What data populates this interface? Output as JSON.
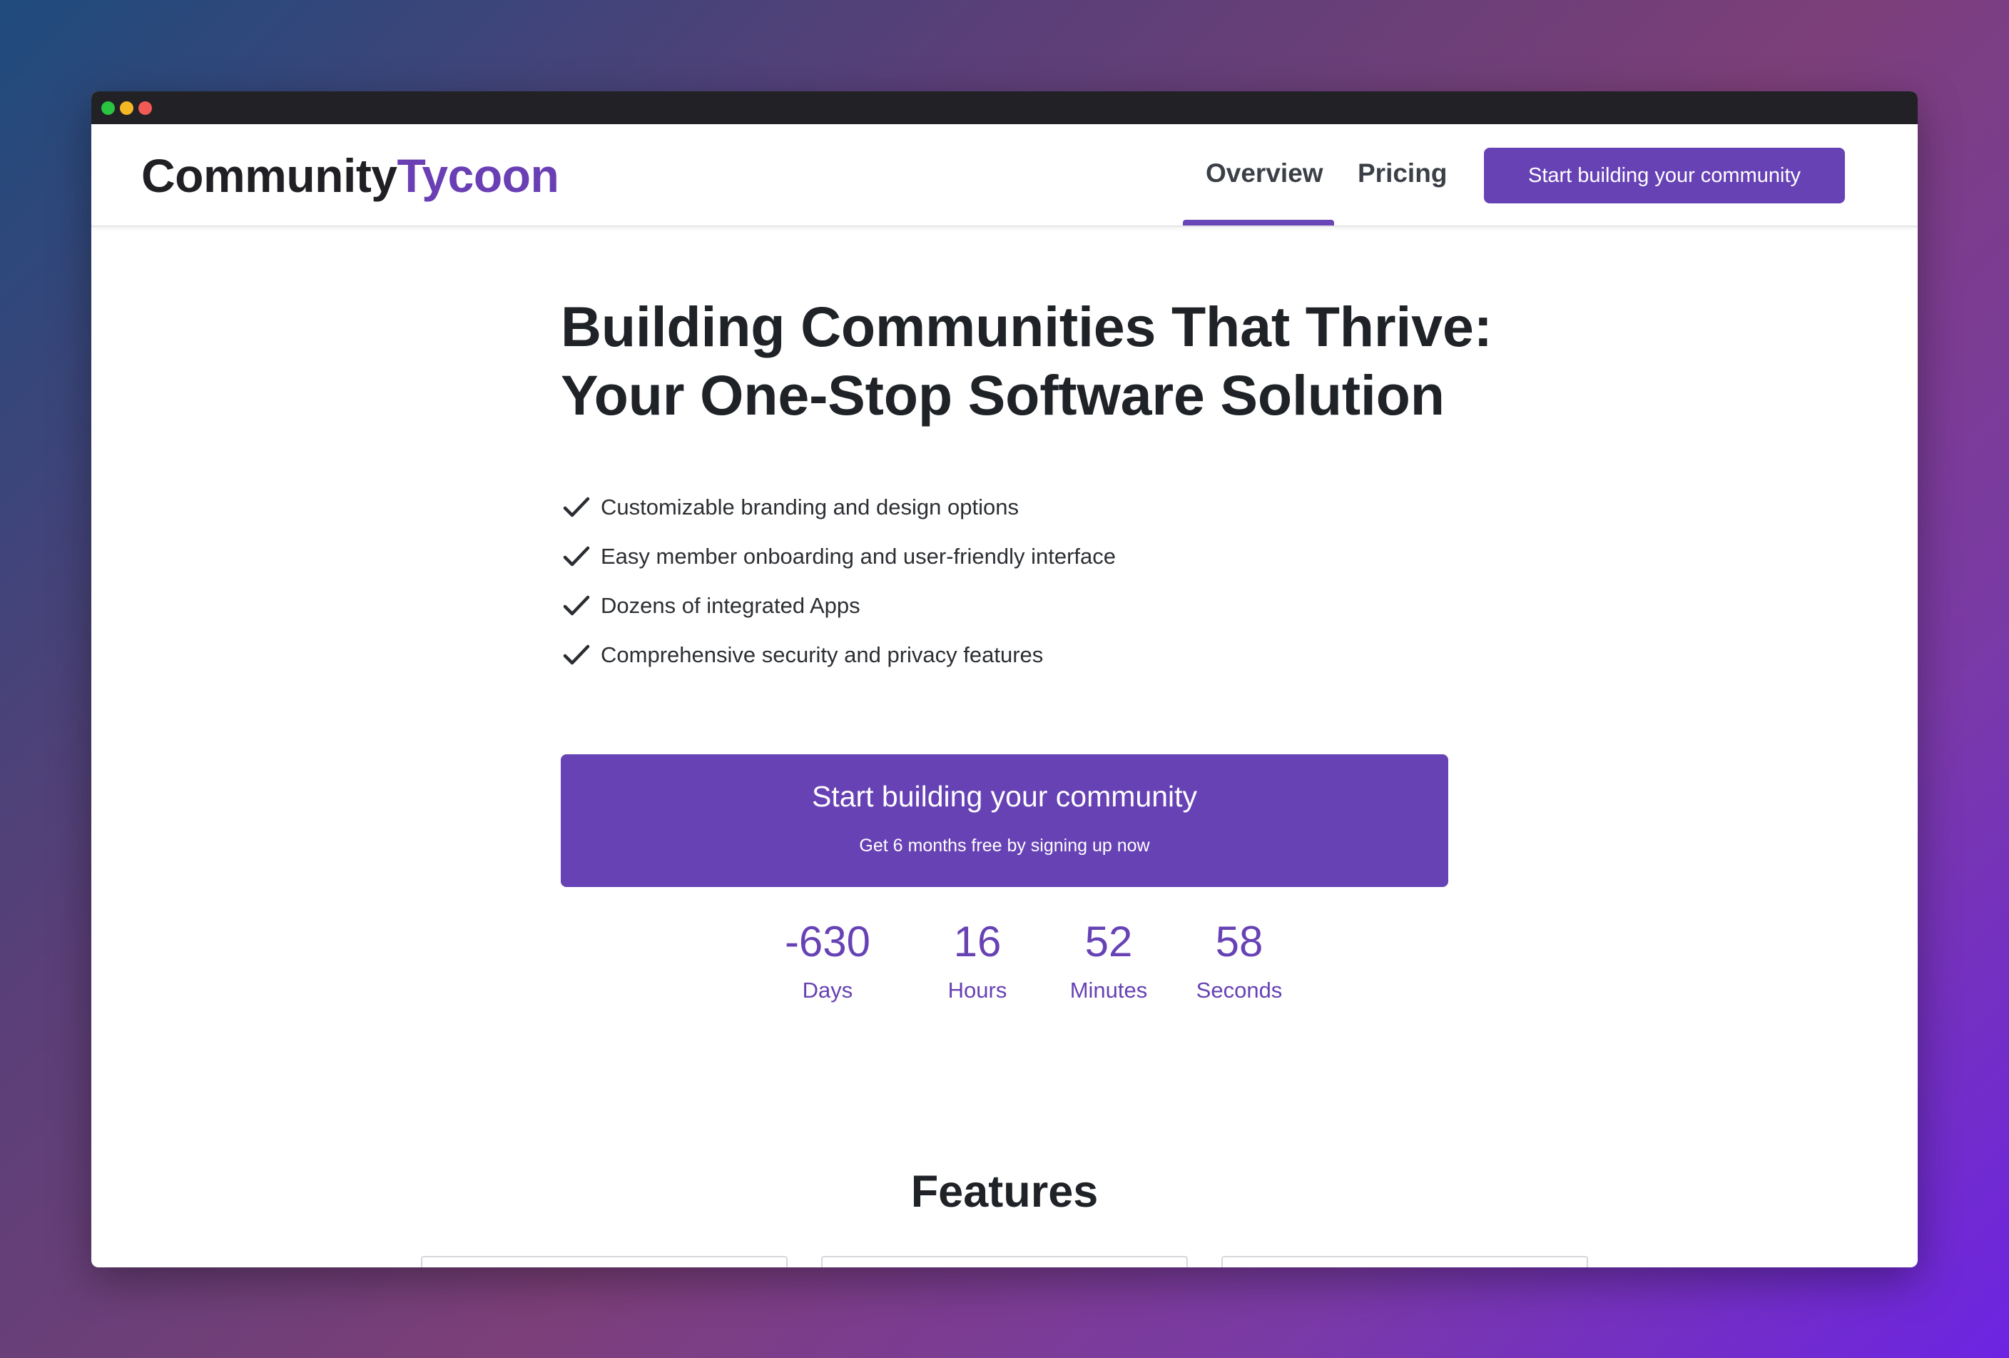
{
  "logo": {
    "part1": "Community",
    "part2": "Tycoon"
  },
  "nav": {
    "links": [
      {
        "label": "Overview",
        "active": true
      },
      {
        "label": "Pricing",
        "active": false
      }
    ],
    "cta_label": "Start building your community"
  },
  "hero": {
    "title_line1": "Building Communities That Thrive:",
    "title_line2": "Your One-Stop Software Solution"
  },
  "features_list": [
    "Customizable branding and design options",
    "Easy member onboarding and user-friendly interface",
    "Dozens of integrated Apps",
    "Comprehensive security and privacy features"
  ],
  "cta": {
    "main_label": "Start building your community",
    "sub_label": "Get 6 months free by signing up now"
  },
  "countdown": [
    {
      "value": "-630",
      "label": "Days"
    },
    {
      "value": "16",
      "label": "Hours"
    },
    {
      "value": "52",
      "label": "Minutes"
    },
    {
      "value": "58",
      "label": "Seconds"
    }
  ],
  "features_section": {
    "heading": "Features"
  },
  "colors": {
    "accent": "#6742b5",
    "text_dark": "#1f2226",
    "titlebar": "#222226"
  },
  "icons": {
    "check": "check-icon"
  }
}
